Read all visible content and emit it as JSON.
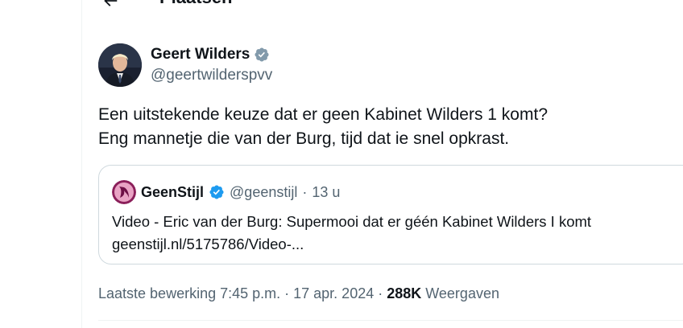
{
  "header": {
    "title": "Plaatsen"
  },
  "author": {
    "name": "Geert Wilders",
    "handle": "@geertwilderspvv"
  },
  "tweet": {
    "line1": "Een uitstekende keuze dat er geen Kabinet Wilders 1 komt?",
    "line2": "Eng mannetje die van der Burg, tijd dat ie snel opkrast."
  },
  "quote": {
    "name": "GeenStijl",
    "handle": "@geenstijl",
    "separator": "·",
    "time": "13 u",
    "body_line1": "Video - Eric van der Burg: Supermooi dat er géén Kabinet Wilders I komt",
    "body_line2": "geenstijl.nl/5175786/Video-..."
  },
  "meta": {
    "edited": "Laatste bewerking 7:45 p.m. · 17 apr. 2024 · ",
    "views_count": "288K",
    "views_label": " Weergaven"
  },
  "colors": {
    "verified_blue": "#1d9bf0",
    "text_primary": "#0f1419",
    "text_secondary": "#536471",
    "border": "#cfd9de"
  },
  "icons": {
    "back": "arrow-left-icon",
    "verified": "verified-badge-icon"
  }
}
